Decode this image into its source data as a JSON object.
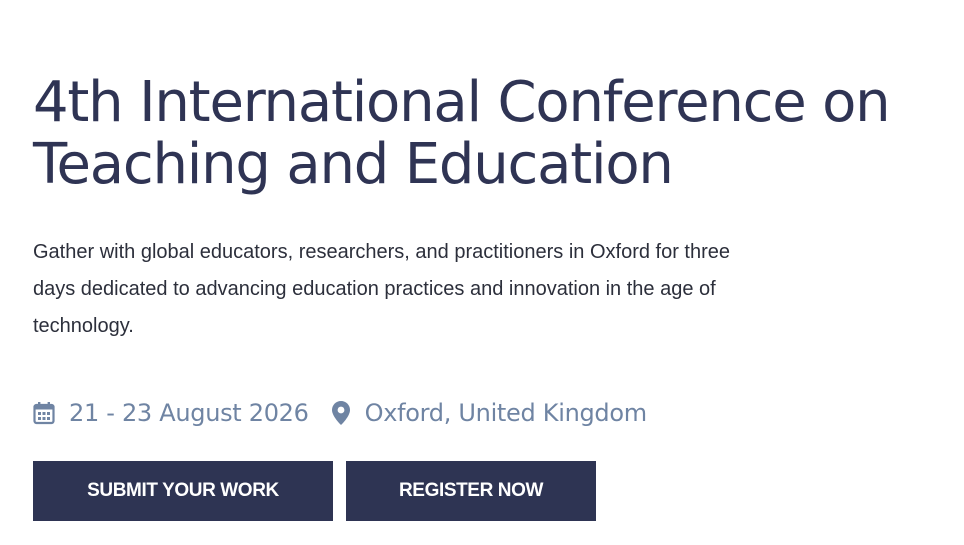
{
  "hero": {
    "title_line1": "4th International Conference on",
    "title_line2": "Teaching and Education",
    "description": "Gather with global educators, researchers, and practitioners in Oxford for three days dedicated to advancing education practices and innovation in the age of technology.",
    "date": "21 - 23 August 2026",
    "location": "Oxford, United Kingdom",
    "icons": {
      "date": "calendar-icon",
      "location": "map-pin-icon"
    },
    "colors": {
      "title": "#2f3454",
      "meta": "#6f84a3",
      "button_bg": "#2e3453",
      "button_text": "#ffffff"
    }
  },
  "buttons": {
    "submit_label": "SUBMIT YOUR WORK",
    "register_label": "REGISTER NOW"
  }
}
